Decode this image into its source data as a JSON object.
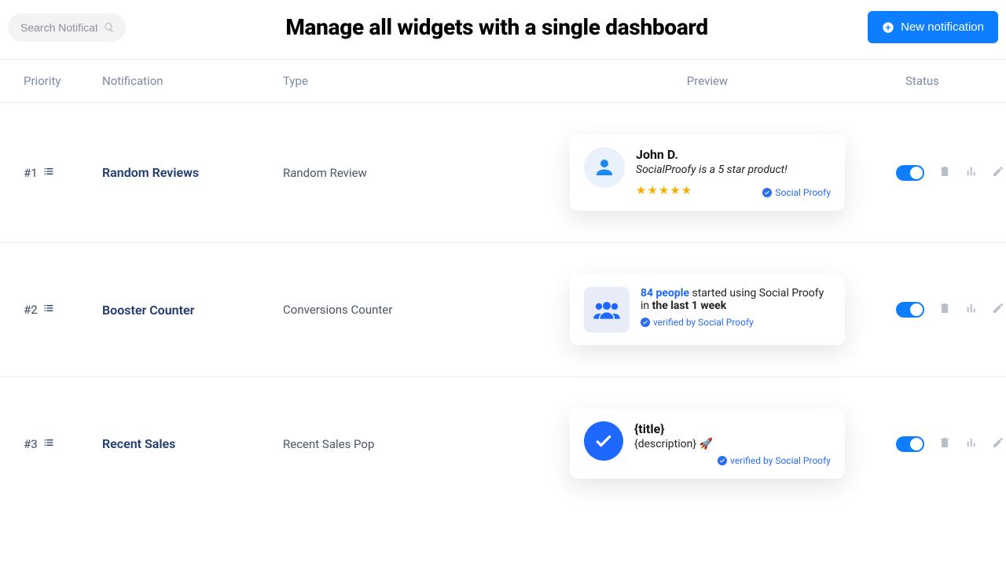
{
  "header": {
    "search_placeholder": "Search Notification",
    "title": "Manage all widgets with a single dashboard",
    "new_btn_label": "New notification"
  },
  "columns": {
    "priority": "Priority",
    "notification": "Notification",
    "type": "Type",
    "preview": "Preview",
    "status": "Status"
  },
  "rows": [
    {
      "priority": "#1",
      "notification": "Random Reviews",
      "type": "Random Review",
      "status_on": true,
      "preview": {
        "variant": "review",
        "name": "John D.",
        "text": "SocialProofy is a 5 star product!",
        "stars": "★★★★★",
        "brand": "Social Proofy"
      }
    },
    {
      "priority": "#2",
      "notification": "Booster Counter",
      "type": "Conversions Counter",
      "status_on": true,
      "preview": {
        "variant": "counter",
        "count_text": "84 people",
        "mid_text": " started using Social Proofy in ",
        "period_text": "the last 1 week",
        "verified": "verified by Social Proofy"
      }
    },
    {
      "priority": "#3",
      "notification": "Recent Sales",
      "type": "Recent Sales Pop",
      "status_on": true,
      "preview": {
        "variant": "sales",
        "title": "{title}",
        "description": "{description} 🚀",
        "verified": "verified by Social Proofy"
      }
    }
  ]
}
